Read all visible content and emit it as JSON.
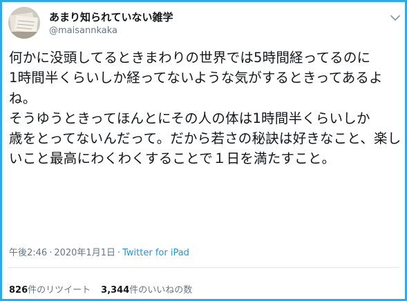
{
  "user": {
    "display_name": "あまり知られていない雑学",
    "handle": "@maisannkaka"
  },
  "tweet": {
    "text": "何かに没頭してるときまわりの世界では5時間経ってるのに\n1時間半くらいしか経ってないような気がするときってあるよね。\nそうゆうときってほんとにその人の体は1時間半くらいしか\n歳をとってないんだって。だから若さの秘訣は好きなこと、楽しいこと最高にわくわくすることで１日を満たすこと。",
    "time": "午後2:46",
    "date": "2020年1月1日",
    "separator": "·",
    "source": "Twitter for iPad"
  },
  "stats": {
    "retweets_count": "826",
    "retweets_label": "件のリツイート",
    "likes_count": "3,344",
    "likes_label": "件のいいねの数"
  },
  "colors": {
    "frame_border": "#2da8e8",
    "link": "#1b95e0",
    "secondary_text": "#657786"
  },
  "icons": {
    "more": "chevron-down-icon"
  }
}
